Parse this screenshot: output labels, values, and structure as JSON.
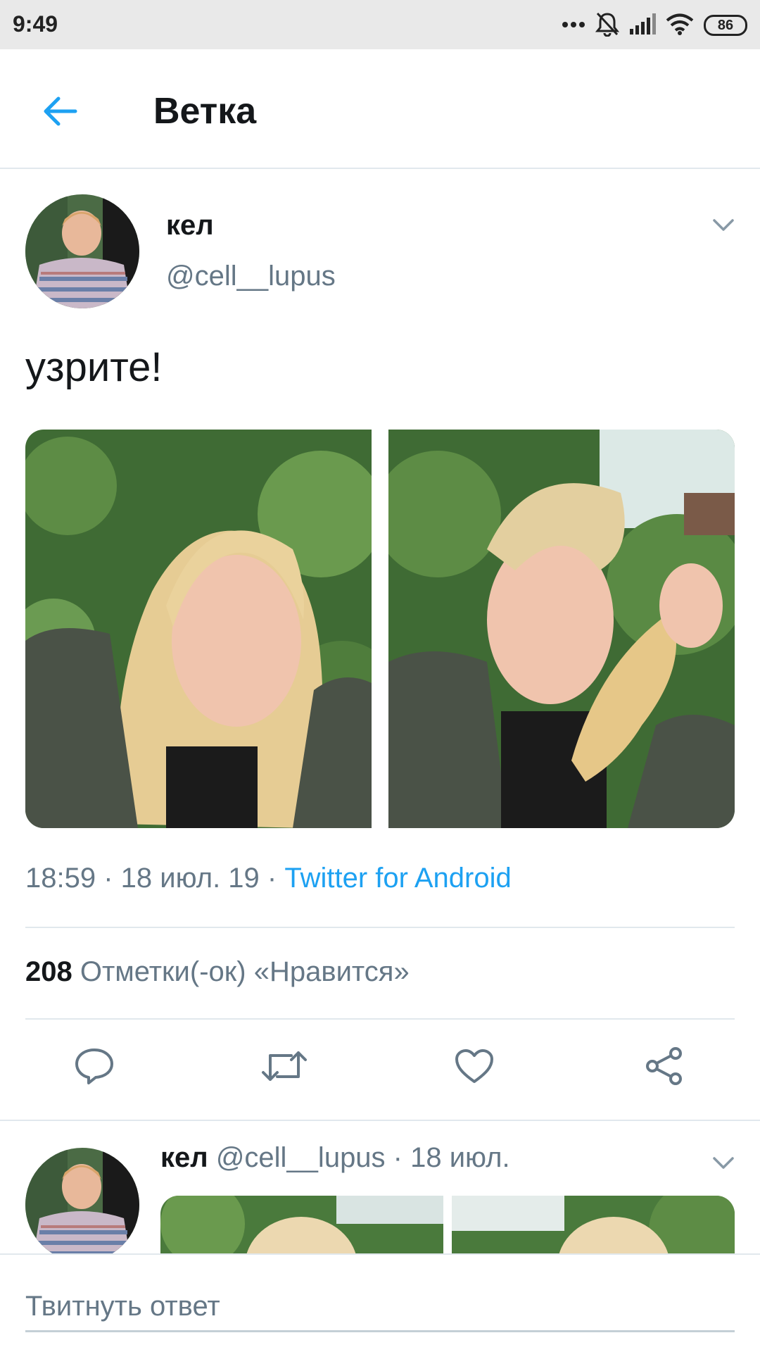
{
  "status_bar": {
    "time": "9:49",
    "battery": "86",
    "icons": [
      "more-dots-icon",
      "bell-muted-icon",
      "signal-icon",
      "wifi-icon",
      "battery-icon"
    ]
  },
  "header": {
    "title": "Ветка",
    "back_icon": "back-arrow-icon"
  },
  "tweet": {
    "author_name": "кел",
    "author_handle": "@cell__lupus",
    "text": "узрите!",
    "time": "18:59",
    "separator": " · ",
    "date": "18 июл. 19",
    "source": "Twitter for Android",
    "likes_count": "208",
    "likes_label": "Отметки(-ок) «Нравится»",
    "actions": [
      "reply-icon",
      "retweet-icon",
      "like-icon",
      "share-icon"
    ]
  },
  "reply": {
    "author_name": "кел",
    "author_handle": "@cell__lupus",
    "separator": " · ",
    "date": "18 июл."
  },
  "compose": {
    "placeholder": "Твитнуть ответ"
  },
  "colors": {
    "accent": "#1da1f2",
    "text_primary": "#14171a",
    "text_secondary": "#657786",
    "divider": "#e1e8ed",
    "status_bar_bg": "#e9e9e9"
  }
}
